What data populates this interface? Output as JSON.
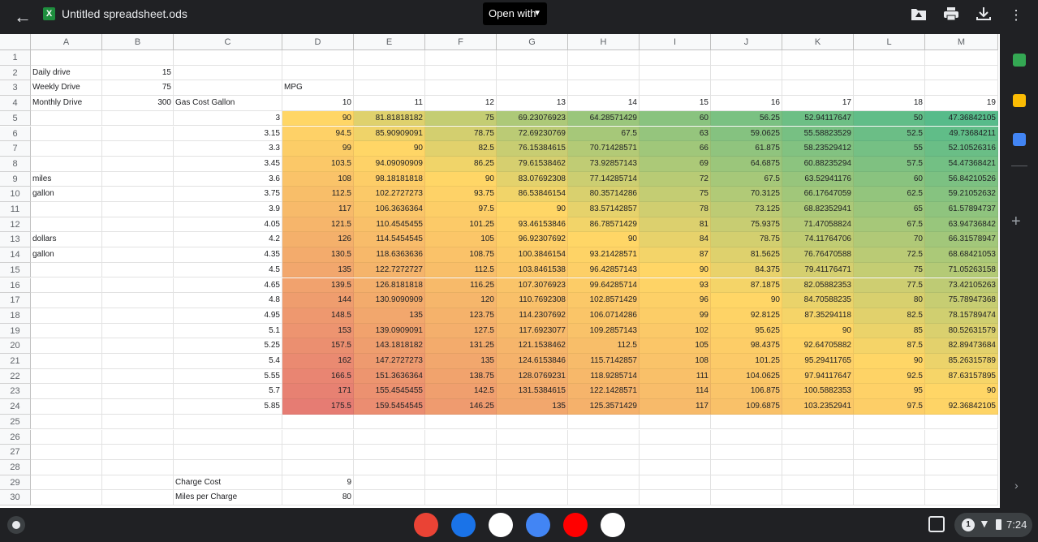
{
  "header": {
    "title": "Untitled spreadsheet.ods",
    "file_icon_letter": "X",
    "open_with_label": "Open with"
  },
  "columns": [
    "A",
    "B",
    "C",
    "D",
    "E",
    "F",
    "G",
    "H",
    "I",
    "J",
    "K",
    "L",
    "M"
  ],
  "rows": [
    "1",
    "2",
    "3",
    "4",
    "5",
    "6",
    "7",
    "8",
    "9",
    "10",
    "11",
    "12",
    "13",
    "14",
    "15",
    "16",
    "17",
    "18",
    "19",
    "20",
    "21",
    "22",
    "23",
    "24",
    "25",
    "26",
    "27",
    "28",
    "29",
    "30"
  ],
  "cells": {
    "A2": "Daily drive",
    "B2": "15",
    "A3": "Weekly Drive",
    "B3": "75",
    "D3": "MPG",
    "A4": "Monthly Drive",
    "B4": "300",
    "C4": "Gas Cost Gallon",
    "A9": "miles",
    "A10": "gallon",
    "A13": "dollars",
    "A14": "gallon",
    "C29": "Charge Cost",
    "D29": "9",
    "C30": "Miles per Charge",
    "D30": "80"
  },
  "mpg_header": [
    "10",
    "11",
    "12",
    "13",
    "14",
    "15",
    "16",
    "17",
    "18",
    "19"
  ],
  "gas_prices": [
    "3",
    "3.15",
    "3.3",
    "3.45",
    "3.6",
    "3.75",
    "3.9",
    "4.05",
    "4.2",
    "4.35",
    "4.5",
    "4.65",
    "4.8",
    "4.95",
    "5.1",
    "5.25",
    "5.4",
    "5.55",
    "5.7",
    "5.85"
  ],
  "table": [
    [
      "90",
      "81.81818182",
      "75",
      "69.23076923",
      "64.28571429",
      "60",
      "56.25",
      "52.94117647",
      "50",
      "47.36842105"
    ],
    [
      "94.5",
      "85.90909091",
      "78.75",
      "72.69230769",
      "67.5",
      "63",
      "59.0625",
      "55.58823529",
      "52.5",
      "49.73684211"
    ],
    [
      "99",
      "90",
      "82.5",
      "76.15384615",
      "70.71428571",
      "66",
      "61.875",
      "58.23529412",
      "55",
      "52.10526316"
    ],
    [
      "103.5",
      "94.09090909",
      "86.25",
      "79.61538462",
      "73.92857143",
      "69",
      "64.6875",
      "60.88235294",
      "57.5",
      "54.47368421"
    ],
    [
      "108",
      "98.18181818",
      "90",
      "83.07692308",
      "77.14285714",
      "72",
      "67.5",
      "63.52941176",
      "60",
      "56.84210526"
    ],
    [
      "112.5",
      "102.2727273",
      "93.75",
      "86.53846154",
      "80.35714286",
      "75",
      "70.3125",
      "66.17647059",
      "62.5",
      "59.21052632"
    ],
    [
      "117",
      "106.3636364",
      "97.5",
      "90",
      "83.57142857",
      "78",
      "73.125",
      "68.82352941",
      "65",
      "61.57894737"
    ],
    [
      "121.5",
      "110.4545455",
      "101.25",
      "93.46153846",
      "86.78571429",
      "81",
      "75.9375",
      "71.47058824",
      "67.5",
      "63.94736842"
    ],
    [
      "126",
      "114.5454545",
      "105",
      "96.92307692",
      "90",
      "84",
      "78.75",
      "74.11764706",
      "70",
      "66.31578947"
    ],
    [
      "130.5",
      "118.6363636",
      "108.75",
      "100.3846154",
      "93.21428571",
      "87",
      "81.5625",
      "76.76470588",
      "72.5",
      "68.68421053"
    ],
    [
      "135",
      "122.7272727",
      "112.5",
      "103.8461538",
      "96.42857143",
      "90",
      "84.375",
      "79.41176471",
      "75",
      "71.05263158"
    ],
    [
      "139.5",
      "126.8181818",
      "116.25",
      "107.3076923",
      "99.64285714",
      "93",
      "87.1875",
      "82.05882353",
      "77.5",
      "73.42105263"
    ],
    [
      "144",
      "130.9090909",
      "120",
      "110.7692308",
      "102.8571429",
      "96",
      "90",
      "84.70588235",
      "80",
      "75.78947368"
    ],
    [
      "148.5",
      "135",
      "123.75",
      "114.2307692",
      "106.0714286",
      "99",
      "92.8125",
      "87.35294118",
      "82.5",
      "78.15789474"
    ],
    [
      "153",
      "139.0909091",
      "127.5",
      "117.6923077",
      "109.2857143",
      "102",
      "95.625",
      "90",
      "85",
      "80.52631579"
    ],
    [
      "157.5",
      "143.1818182",
      "131.25",
      "121.1538462",
      "112.5",
      "105",
      "98.4375",
      "92.64705882",
      "87.5",
      "82.89473684"
    ],
    [
      "162",
      "147.2727273",
      "135",
      "124.6153846",
      "115.7142857",
      "108",
      "101.25",
      "95.29411765",
      "90",
      "85.26315789"
    ],
    [
      "166.5",
      "151.3636364",
      "138.75",
      "128.0769231",
      "118.9285714",
      "111",
      "104.0625",
      "97.94117647",
      "92.5",
      "87.63157895"
    ],
    [
      "171",
      "155.4545455",
      "142.5",
      "131.5384615",
      "122.1428571",
      "114",
      "106.875",
      "100.5882353",
      "95",
      "90"
    ],
    [
      "175.5",
      "159.5454545",
      "146.25",
      "135",
      "125.3571429",
      "117",
      "109.6875",
      "103.2352941",
      "97.5",
      "92.36842105"
    ]
  ],
  "color_scale": {
    "min": "#57bb8a",
    "mid": "#ffd666",
    "max": "#e67c73",
    "min_value": 47.36842105,
    "mid_value": 90,
    "max_value": 175.5
  },
  "icons": {
    "back": "back-arrow-icon",
    "download_drive": "add-to-drive-icon",
    "print": "print-icon",
    "download": "download-icon",
    "more": "more-vert-icon",
    "launcher": "launcher-icon",
    "tote": "tote-icon",
    "wifi": "wifi-icon",
    "battery": "battery-icon"
  },
  "side_panel_colors": [
    "#34a853",
    "#fbbc04",
    "#4285f4"
  ],
  "taskbar": {
    "apps": [
      {
        "name": "Chrome",
        "color": "#ea4335"
      },
      {
        "name": "Files",
        "color": "#1a73e8"
      },
      {
        "name": "Gmail",
        "color": "#ffffff"
      },
      {
        "name": "Docs",
        "color": "#4285f4"
      },
      {
        "name": "YouTube",
        "color": "#ff0000"
      },
      {
        "name": "Play Store",
        "color": "#ffffff"
      }
    ],
    "notification_count": "1",
    "time": "7:24"
  }
}
